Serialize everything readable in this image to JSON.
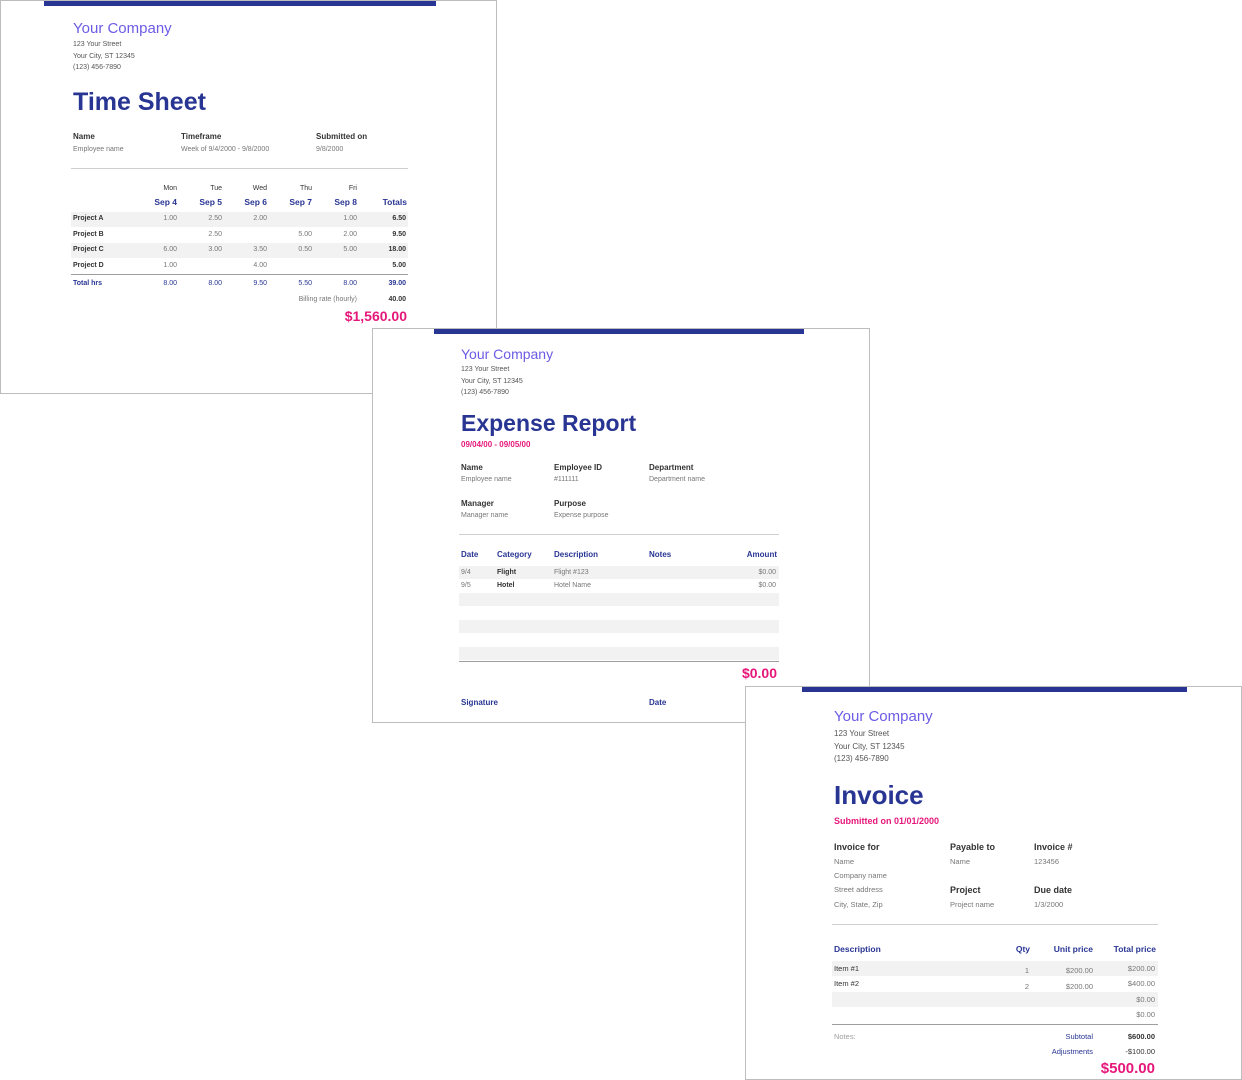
{
  "colors": {
    "accent": "#283593",
    "company": "#6a5ce5",
    "pink": "#e6177a",
    "shade": "#f2f2f2"
  },
  "timesheet": {
    "company": "Your Company",
    "address": [
      "123 Your Street",
      "Your City, ST 12345",
      "(123) 456-7890"
    ],
    "title": "Time Sheet",
    "fields": [
      {
        "label": "Name",
        "value": "Employee name"
      },
      {
        "label": "Timeframe",
        "value": "Week of 9/4/2000 - 9/8/2000"
      },
      {
        "label": "Submitted on",
        "value": "9/8/2000"
      }
    ],
    "days": [
      "Mon",
      "Tue",
      "Wed",
      "Thu",
      "Fri"
    ],
    "dates": [
      "Sep 4",
      "Sep 5",
      "Sep 6",
      "Sep 7",
      "Sep 8"
    ],
    "totals_header": "Totals",
    "rows": [
      {
        "name": "Project A",
        "cells": [
          "1.00",
          "2.50",
          "2.00",
          "",
          "1.00"
        ],
        "total": "6.50"
      },
      {
        "name": "Project B",
        "cells": [
          "",
          "2.50",
          "",
          "5.00",
          "2.00"
        ],
        "total": "9.50"
      },
      {
        "name": "Project C",
        "cells": [
          "6.00",
          "3.00",
          "3.50",
          "0.50",
          "5.00"
        ],
        "total": "18.00"
      },
      {
        "name": "Project D",
        "cells": [
          "1.00",
          "",
          "4.00",
          "",
          ""
        ],
        "total": "5.00"
      }
    ],
    "total_row": {
      "name": "Total hrs",
      "cells": [
        "8.00",
        "8.00",
        "9.50",
        "5.50",
        "8.00"
      ],
      "total": "39.00"
    },
    "billing_label": "Billing rate (hourly)",
    "billing_value": "40.00",
    "grand_total": "$1,560.00"
  },
  "expense": {
    "company": "Your Company",
    "address": [
      "123 Your Street",
      "Your City, ST 12345",
      "(123) 456-7890"
    ],
    "title": "Expense Report",
    "range": "09/04/00 - 09/05/00",
    "fields": [
      {
        "label": "Name",
        "value": "Employee name"
      },
      {
        "label": "Employee ID",
        "value": "#111111"
      },
      {
        "label": "Department",
        "value": "Department name"
      },
      {
        "label": "Manager",
        "value": "Manager name"
      },
      {
        "label": "Purpose",
        "value": "Expense purpose"
      }
    ],
    "headers": [
      "Date",
      "Category",
      "Description",
      "Notes",
      "Amount"
    ],
    "rows": [
      {
        "date": "9/4",
        "category": "Flight",
        "description": "Flight #123",
        "notes": "",
        "amount": "$0.00"
      },
      {
        "date": "9/5",
        "category": "Hotel",
        "description": "Hotel Name",
        "notes": "",
        "amount": "$0.00"
      }
    ],
    "total": "$0.00",
    "signature_label": "Signature",
    "date_label": "Date"
  },
  "invoice": {
    "company": "Your Company",
    "address": [
      "123 Your Street",
      "Your City, ST 12345",
      "(123) 456-7890"
    ],
    "title": "Invoice",
    "submitted": "Submitted on 01/01/2000",
    "invoice_for_label": "Invoice for",
    "invoice_for_values": [
      "Name",
      "Company name",
      "Street address",
      "City, State, Zip"
    ],
    "payable_label": "Payable to",
    "payable_value": "Name",
    "invoice_no_label": "Invoice #",
    "invoice_no_value": "123456",
    "project_label": "Project",
    "project_value": "Project name",
    "due_label": "Due date",
    "due_value": "1/3/2000",
    "headers": [
      "Description",
      "Qty",
      "Unit price",
      "Total price"
    ],
    "items": [
      {
        "description": "Item #1",
        "qty": "1",
        "unit": "$200.00",
        "total": "$200.00"
      },
      {
        "description": "Item #2",
        "qty": "2",
        "unit": "$200.00",
        "total": "$400.00"
      },
      {
        "description": "",
        "qty": "",
        "unit": "",
        "total": "$0.00"
      },
      {
        "description": "",
        "qty": "",
        "unit": "",
        "total": "$0.00"
      }
    ],
    "notes_label": "Notes:",
    "subtotal_label": "Subtotal",
    "subtotal_value": "$600.00",
    "adjustments_label": "Adjustments",
    "adjustments_value": "-$100.00",
    "grand_total": "$500.00"
  }
}
